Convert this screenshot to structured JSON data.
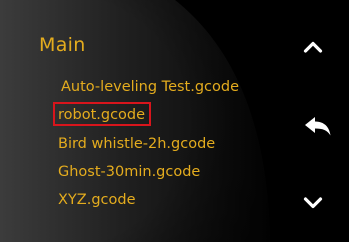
{
  "screen": {
    "title": "Main",
    "colors": {
      "background": "#000000",
      "text_accent": "#e4ac1e",
      "selection_border": "#d8151c",
      "icon": "#ffffff"
    }
  },
  "file_list": {
    "selected_index": 1,
    "items": [
      {
        "label": "Auto-leveling Test.gcode"
      },
      {
        "label": "robot.gcode"
      },
      {
        "label": "Bird whistle-2h.gcode"
      },
      {
        "label": "Ghost-30min.gcode"
      },
      {
        "label": "XYZ.gcode"
      }
    ]
  },
  "navigation": {
    "up_icon": "chevron-up-icon",
    "back_icon": "back-arrow-icon",
    "down_icon": "chevron-down-icon"
  }
}
